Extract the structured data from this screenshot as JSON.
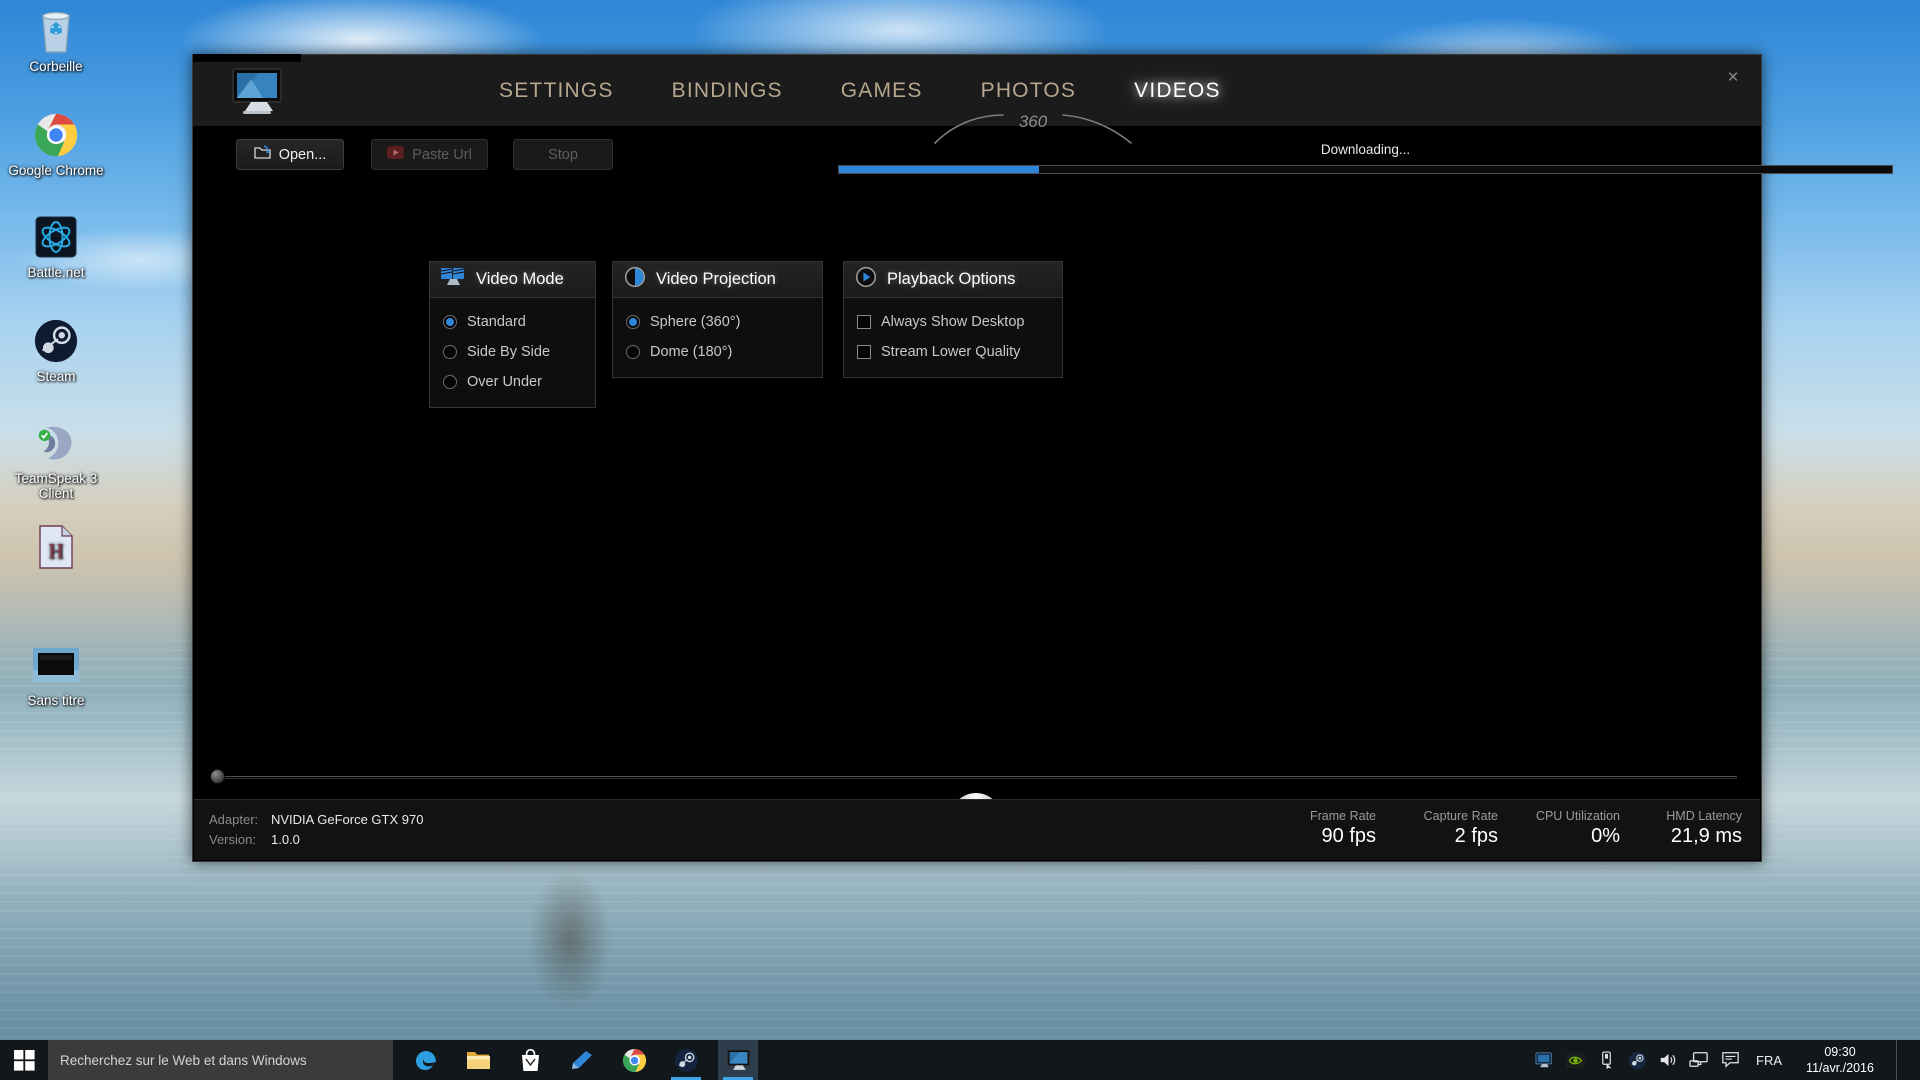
{
  "desktop": {
    "icons": [
      {
        "label": "Corbeille",
        "icon": "recycle-bin-icon"
      },
      {
        "label": "Google Chrome",
        "icon": "chrome-icon"
      },
      {
        "label": "Battle.net",
        "icon": "battlenet-icon"
      },
      {
        "label": "Steam",
        "icon": "steam-icon"
      },
      {
        "label": "TeamSpeak 3 Client",
        "icon": "teamspeak-icon"
      },
      {
        "label": "",
        "icon": "html-document-icon"
      },
      {
        "label": "Sans titre",
        "icon": "image-thumbnail-icon"
      }
    ]
  },
  "app": {
    "logo_icon": "monitor-icon",
    "close_label": "×",
    "arc_label": "360",
    "tabs": [
      {
        "label": "SETTINGS",
        "active": false
      },
      {
        "label": "BINDINGS",
        "active": false
      },
      {
        "label": "GAMES",
        "active": false
      },
      {
        "label": "PHOTOS",
        "active": false
      },
      {
        "label": "VIDEOS",
        "active": true
      }
    ],
    "toolbar": {
      "open_label": "Open...",
      "open_icon": "open-folder-icon",
      "paste_label": "Paste Url",
      "paste_icon": "youtube-play-icon",
      "stop_label": "Stop"
    },
    "progress": {
      "status_text": "Downloading...",
      "percent": 19,
      "fill_color": "#2f86d8"
    },
    "panels": {
      "video_mode": {
        "title": "Video Mode",
        "icon": "clapperboard-monitor-icon",
        "options": [
          {
            "label": "Standard",
            "selected": true
          },
          {
            "label": "Side By Side",
            "selected": false
          },
          {
            "label": "Over Under",
            "selected": false
          }
        ]
      },
      "video_projection": {
        "title": "Video Projection",
        "icon": "half-circle-icon",
        "options": [
          {
            "label": "Sphere (360°)",
            "selected": true
          },
          {
            "label": "Dome (180°)",
            "selected": false
          }
        ]
      },
      "playback_options": {
        "title": "Playback Options",
        "icon": "play-circle-icon",
        "options": [
          {
            "label": "Always Show Desktop",
            "checked": false
          },
          {
            "label": "Stream Lower Quality",
            "checked": false
          }
        ]
      }
    },
    "player": {
      "seek_position_percent": 0,
      "play_icon": "play-button-icon"
    },
    "status": {
      "adapter_label": "Adapter:",
      "adapter_value": "NVIDIA GeForce GTX 970",
      "version_label": "Version:",
      "version_value": "1.0.0",
      "stats": [
        {
          "label": "Frame Rate",
          "value": "90 fps"
        },
        {
          "label": "Capture Rate",
          "value": "2 fps"
        },
        {
          "label": "CPU Utilization",
          "value": "0%"
        },
        {
          "label": "HMD Latency",
          "value": "21,9 ms"
        }
      ]
    }
  },
  "taskbar": {
    "start_icon": "windows-start-icon",
    "search_placeholder": "Recherchez sur le Web et dans Windows",
    "apps": [
      {
        "icon": "edge-icon"
      },
      {
        "icon": "file-explorer-icon"
      },
      {
        "icon": "store-icon"
      },
      {
        "icon": "blue-app-icon"
      },
      {
        "icon": "chrome-icon"
      },
      {
        "icon": "steam-icon"
      },
      {
        "icon": "monitor-app-icon"
      }
    ],
    "tray": [
      {
        "icon": "monitor-tray-icon"
      },
      {
        "icon": "nvidia-icon"
      },
      {
        "icon": "usb-eject-icon"
      },
      {
        "icon": "steam-tray-icon"
      },
      {
        "icon": "volume-icon"
      },
      {
        "icon": "network-icon"
      },
      {
        "icon": "action-center-icon"
      }
    ],
    "language": "FRA",
    "time": "09:30",
    "date": "11/avr./2016"
  }
}
